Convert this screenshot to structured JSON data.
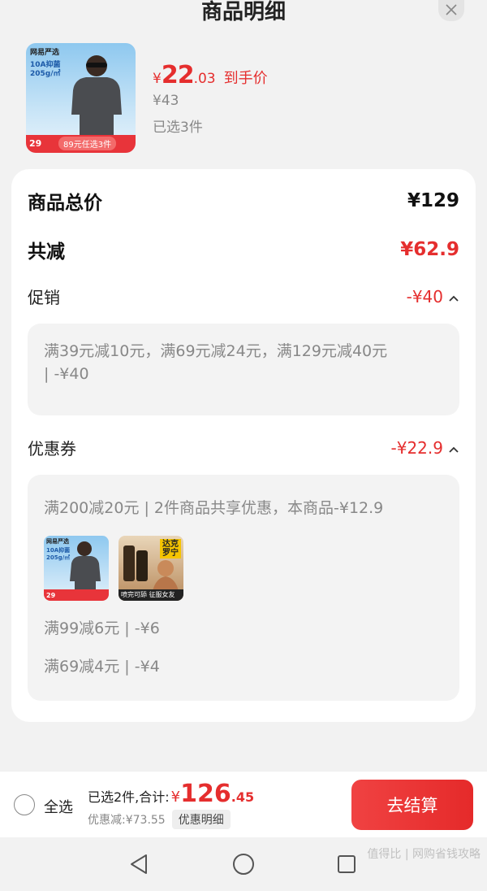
{
  "header": {
    "title": "商品明细",
    "close_icon": "close-icon"
  },
  "product": {
    "thumb_brand": "网易严选",
    "thumb_spec": "10A抑菌\n205g/㎡",
    "thumb_band_left": "29",
    "thumb_band_right": "89元任选3件",
    "price_symbol": "¥",
    "price_int": "22",
    "price_dec": ".03",
    "price_tag": "到手价",
    "original_price": "¥43",
    "selected_text": "已选3件"
  },
  "summary_card": {
    "total_label": "商品总价",
    "total_value": "¥129",
    "reduce_label": "共减",
    "reduce_value": "¥62.9",
    "promo": {
      "label": "促销",
      "value": "-¥40",
      "detail": "满39元减10元，满69元减24元，满129元减40元\n| -¥40"
    },
    "coupon": {
      "label": "优惠券",
      "value": "-¥22.9",
      "line1": "满200减20元 | 2件商品共享优惠，本商品-¥12.9",
      "items": [
        {
          "brand": "网易严选",
          "spec": "10A抑菌\n205g/㎡",
          "band": "29"
        },
        {
          "title": "达克\n罗宁",
          "band": "喷完可舔 征服女友"
        }
      ],
      "line2": "满99减6元 | -¥6",
      "line3": "满69减4元 | -¥4"
    }
  },
  "bottom_bar": {
    "select_all": "全选",
    "selected_total_label": "已选2件,合计:",
    "total_symbol": "¥",
    "total_int": "126",
    "total_dec": ".45",
    "discount_text": "优惠减:¥73.55",
    "detail_button": "优惠明细",
    "checkout_button": "去结算"
  },
  "navbar": {
    "back": "back-icon",
    "home": "home-icon",
    "recent": "recent-icon"
  },
  "watermark": "值得比 | 网购省钱攻略"
}
